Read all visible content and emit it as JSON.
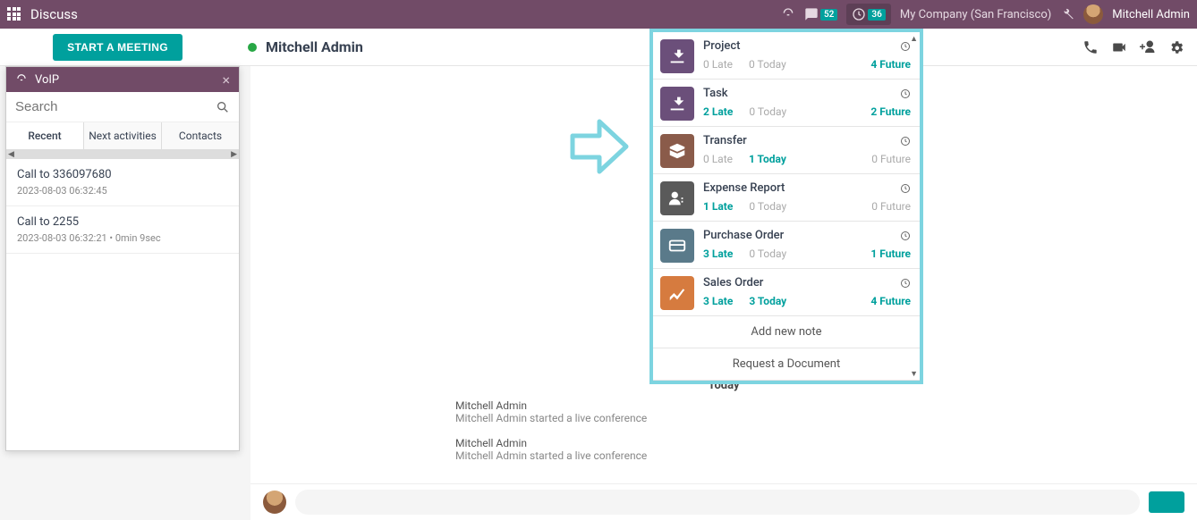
{
  "navbar": {
    "title": "Discuss",
    "message_badge": "52",
    "activity_badge": "36",
    "company": "My Company (San Francisco)",
    "user": "Mitchell Admin"
  },
  "header": {
    "start_meeting": "START A MEETING",
    "title": "Mitchell Admin"
  },
  "voip": {
    "title": "VoIP",
    "search_placeholder": "Search",
    "tabs": {
      "recent": "Recent",
      "next": "Next activities",
      "contacts": "Contacts"
    },
    "calls": [
      {
        "title": "Call to 336097680",
        "time": "2023-08-03 06:32:45"
      },
      {
        "title": "Call to 2255",
        "time": "2023-08-03 06:32:21 • 0min 9sec"
      }
    ]
  },
  "activities": {
    "items": [
      {
        "name": "Project",
        "late": "0 Late",
        "late_active": false,
        "today": "0 Today",
        "today_active": false,
        "future": "4 Future",
        "future_active": true,
        "icon_bg": "#6b4f7a"
      },
      {
        "name": "Task",
        "late": "2 Late",
        "late_active": true,
        "today": "0 Today",
        "today_active": false,
        "future": "2 Future",
        "future_active": true,
        "icon_bg": "#6b4f7a"
      },
      {
        "name": "Transfer",
        "late": "0 Late",
        "late_active": false,
        "today": "1 Today",
        "today_active": true,
        "future": "0 Future",
        "future_active": false,
        "icon_bg": "#8a5b4a"
      },
      {
        "name": "Expense Report",
        "late": "1 Late",
        "late_active": true,
        "today": "0 Today",
        "today_active": false,
        "future": "0 Future",
        "future_active": false,
        "icon_bg": "#5a5a5a"
      },
      {
        "name": "Purchase Order",
        "late": "3 Late",
        "late_active": true,
        "today": "0 Today",
        "today_active": false,
        "future": "1 Future",
        "future_active": true,
        "icon_bg": "#5a7a8a"
      },
      {
        "name": "Sales Order",
        "late": "3 Late",
        "late_active": true,
        "today": "3 Today",
        "today_active": true,
        "future": "4 Future",
        "future_active": true,
        "icon_bg": "#d67b3f"
      }
    ],
    "add_note": "Add new note",
    "request_doc": "Request a Document"
  },
  "chat": {
    "separator": "Today",
    "messages": [
      {
        "author": "Mitchell Admin",
        "body": "Mitchell Admin started a live conference"
      },
      {
        "author": "Mitchell Admin",
        "body": "Mitchell Admin started a live conference"
      }
    ]
  }
}
